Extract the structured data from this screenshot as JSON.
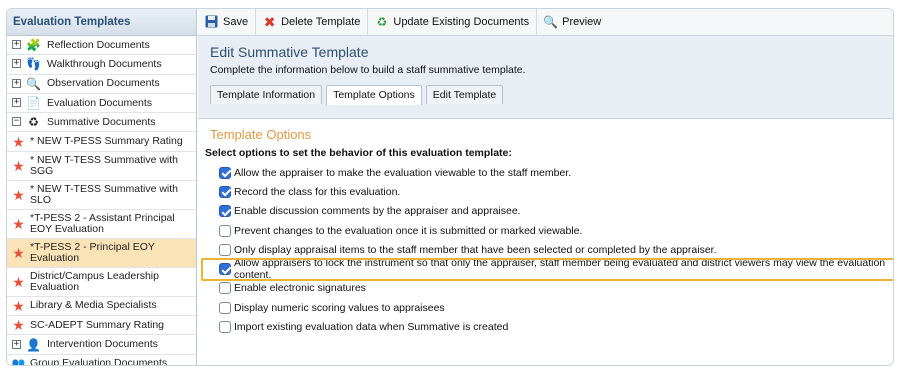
{
  "sidebar": {
    "title": "Evaluation Templates",
    "items": [
      {
        "label": "Reflection Documents",
        "type": "folder",
        "expander": "+",
        "icon": "puzzle-icon",
        "icon_glyph": "🧩"
      },
      {
        "label": "Walkthrough Documents",
        "type": "folder",
        "expander": "+",
        "icon": "footsteps-icon",
        "icon_glyph": "👣"
      },
      {
        "label": "Observation Documents",
        "type": "folder",
        "expander": "+",
        "icon": "magnifier-icon",
        "icon_glyph": "🔍"
      },
      {
        "label": "Evaluation Documents",
        "type": "folder",
        "expander": "+",
        "icon": "document-lock-icon",
        "icon_glyph": "📄"
      },
      {
        "label": "Summative Documents",
        "type": "folder",
        "expander": "−",
        "icon": "recycle-icon",
        "icon_glyph": "♻"
      },
      {
        "label": "* NEW T-PESS Summary Rating",
        "type": "leaf"
      },
      {
        "label": "* NEW T-TESS Summative with SGG",
        "type": "leaf"
      },
      {
        "label": "* NEW T-TESS Summative with SLO",
        "type": "leaf"
      },
      {
        "label": "*T-PESS 2 - Assistant Principal EOY Evaluation",
        "type": "leaf"
      },
      {
        "label": "*T-PESS 2 - Principal EOY Evaluation",
        "type": "leaf",
        "selected": true
      },
      {
        "label": "District/Campus Leadership Evaluation",
        "type": "leaf"
      },
      {
        "label": "Library & Media Specialists",
        "type": "leaf"
      },
      {
        "label": "SC-ADEPT Summary Rating",
        "type": "leaf"
      },
      {
        "label": "Intervention Documents",
        "type": "folder",
        "expander": "+",
        "icon": "person-lock-icon",
        "icon_glyph": "👤"
      },
      {
        "label": "Group Evaluation Documents",
        "type": "group",
        "icon": "group-icon",
        "icon_glyph": "👥"
      }
    ]
  },
  "toolbar": {
    "save": "Save",
    "delete": "Delete Template",
    "update": "Update Existing Documents",
    "preview": "Preview"
  },
  "edit": {
    "title": "Edit Summative Template",
    "description": "Complete the information below to build a staff summative template."
  },
  "tabs": [
    "Template Information",
    "Template Options",
    "Edit Template"
  ],
  "active_tab": "Template Options",
  "options": {
    "heading": "Template Options",
    "intro": "Select options to set the behavior of this evaluation template:",
    "items": [
      {
        "label": "Allow the appraiser to make the evaluation viewable to the staff member.",
        "checked": true
      },
      {
        "label": "Record the class for this evaluation.",
        "checked": true
      },
      {
        "label": "Enable discussion comments by the appraiser and appraisee.",
        "checked": true
      },
      {
        "label": "Prevent changes to the evaluation once it is submitted or marked viewable.",
        "checked": false
      },
      {
        "label": "Only display appraisal items to the staff member that have been selected or completed by the appraiser.",
        "checked": false
      },
      {
        "label": "Allow appraisers to lock the instrument so that only the appraiser, staff member being evaluated and district viewers may view the evaluation content.",
        "checked": true,
        "highlighted": true
      },
      {
        "label": "Enable electronic signatures",
        "checked": false
      },
      {
        "label": "Display numeric scoring values to appraisees",
        "checked": false
      },
      {
        "label": "Import existing evaluation data when Summative is created",
        "checked": false
      }
    ]
  },
  "colors": {
    "highlight": "#f0b233",
    "heading": "#e39a43",
    "title": "#2e4e73",
    "selected_row": "#fbe3b8"
  }
}
